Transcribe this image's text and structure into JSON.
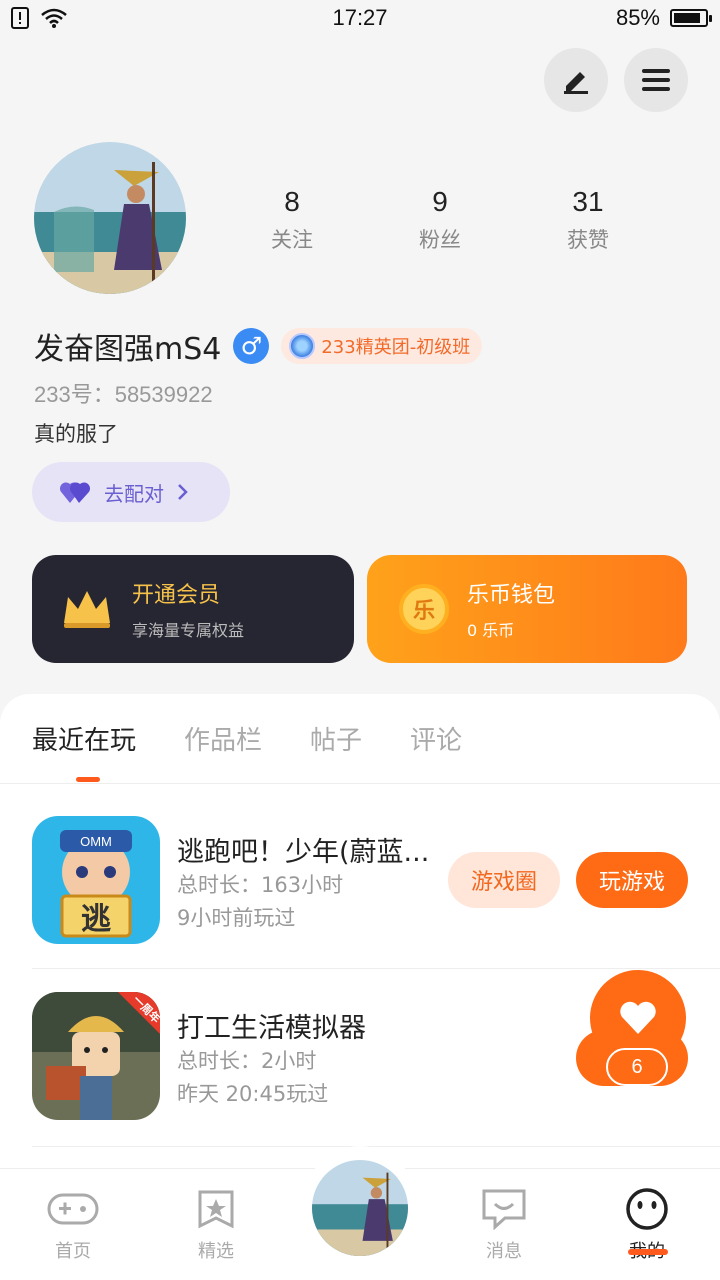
{
  "status": {
    "time": "17:27",
    "battery": "85%",
    "battery_level": 0.85
  },
  "profile": {
    "following_count": "8",
    "following_label": "关注",
    "fans_count": "9",
    "fans_label": "粉丝",
    "likes_count": "31",
    "likes_label": "获赞",
    "username": "发奋图强mS4",
    "gender_symbol": "♂",
    "badge": "233精英团-初级班",
    "uid": "233号：58539922",
    "bio": "真的服了",
    "match_label": "去配对"
  },
  "cards": {
    "vip_title": "开通会员",
    "vip_sub": "享海量专属权益",
    "coin_icon_text": "乐",
    "coin_title": "乐币钱包",
    "coin_sub": "0 乐币"
  },
  "tabs": [
    "最近在玩",
    "作品栏",
    "帖子",
    "评论"
  ],
  "games": [
    {
      "name": "逃跑吧！少年(蔚蓝...",
      "duration": "总时长：163小时",
      "last_played": "9小时前玩过",
      "icon_text": "逃",
      "icon_cap": "OMM"
    },
    {
      "name": "打工生活模拟器",
      "duration": "总时长：2小时",
      "last_played": "昨天 20:45玩过",
      "icon_banner": "一周年"
    }
  ],
  "buttons": {
    "game_circle": "游戏圈",
    "play": "玩游戏"
  },
  "fab": {
    "count": "6"
  },
  "nav": {
    "home": "首页",
    "featured": "精选",
    "messages": "消息",
    "mine": "我的"
  },
  "colors": {
    "accent": "#ff6a15",
    "vip_bg": "#262632",
    "gender": "#3b8bf5"
  }
}
